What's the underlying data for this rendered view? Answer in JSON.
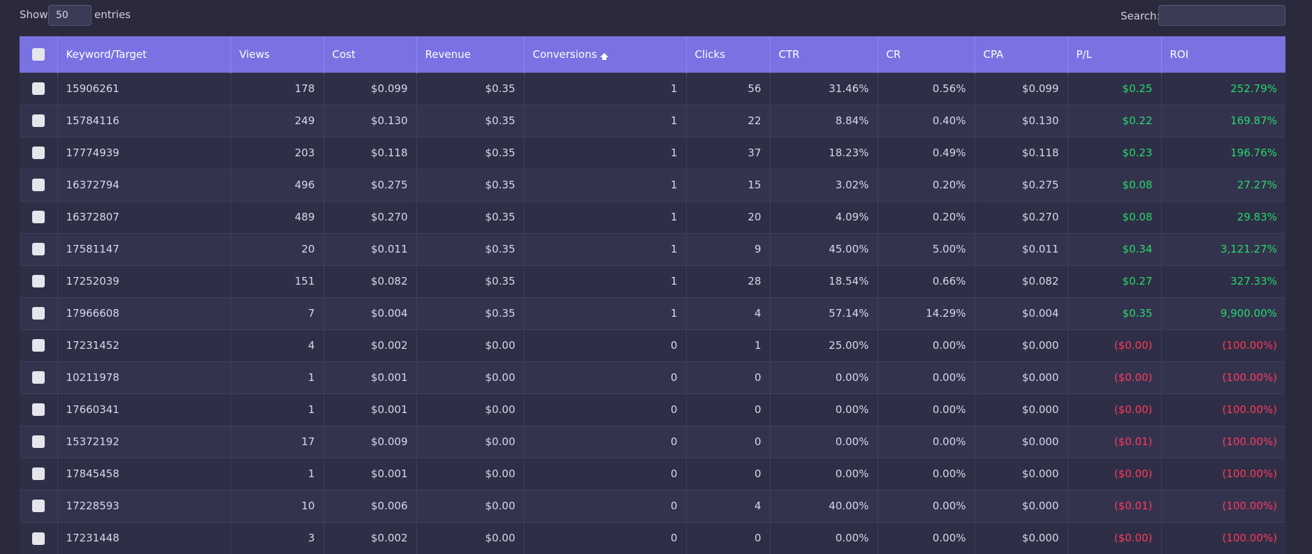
{
  "controls": {
    "show_label": "Show",
    "entries_value": "50",
    "entries_label": "entries",
    "search_label": "Search:",
    "search_value": ""
  },
  "table": {
    "headers": [
      "Keyword/Target",
      "Views",
      "Cost",
      "Revenue",
      "Conversions",
      "Clicks",
      "CTR",
      "CR",
      "CPA",
      "P/L",
      "ROI"
    ],
    "sorted_column": "Conversions",
    "sort_icon": "sort-asc-icon",
    "colors": {
      "header_bg": "#7a72e2",
      "positive": "#27d96b",
      "negative": "#ff3b5a"
    },
    "rows": [
      [
        "15906261",
        "178",
        "$0.099",
        "$0.35",
        "1",
        "56",
        "31.46%",
        "0.56%",
        "$0.099",
        "$0.25",
        "252.79%"
      ],
      [
        "15784116",
        "249",
        "$0.130",
        "$0.35",
        "1",
        "22",
        "8.84%",
        "0.40%",
        "$0.130",
        "$0.22",
        "169.87%"
      ],
      [
        "17774939",
        "203",
        "$0.118",
        "$0.35",
        "1",
        "37",
        "18.23%",
        "0.49%",
        "$0.118",
        "$0.23",
        "196.76%"
      ],
      [
        "16372794",
        "496",
        "$0.275",
        "$0.35",
        "1",
        "15",
        "3.02%",
        "0.20%",
        "$0.275",
        "$0.08",
        "27.27%"
      ],
      [
        "16372807",
        "489",
        "$0.270",
        "$0.35",
        "1",
        "20",
        "4.09%",
        "0.20%",
        "$0.270",
        "$0.08",
        "29.83%"
      ],
      [
        "17581147",
        "20",
        "$0.011",
        "$0.35",
        "1",
        "9",
        "45.00%",
        "5.00%",
        "$0.011",
        "$0.34",
        "3,121.27%"
      ],
      [
        "17252039",
        "151",
        "$0.082",
        "$0.35",
        "1",
        "28",
        "18.54%",
        "0.66%",
        "$0.082",
        "$0.27",
        "327.33%"
      ],
      [
        "17966608",
        "7",
        "$0.004",
        "$0.35",
        "1",
        "4",
        "57.14%",
        "14.29%",
        "$0.004",
        "$0.35",
        "9,900.00%"
      ],
      [
        "17231452",
        "4",
        "$0.002",
        "$0.00",
        "0",
        "1",
        "25.00%",
        "0.00%",
        "$0.000",
        "($0.00)",
        "(100.00%)"
      ],
      [
        "10211978",
        "1",
        "$0.001",
        "$0.00",
        "0",
        "0",
        "0.00%",
        "0.00%",
        "$0.000",
        "($0.00)",
        "(100.00%)"
      ],
      [
        "17660341",
        "1",
        "$0.001",
        "$0.00",
        "0",
        "0",
        "0.00%",
        "0.00%",
        "$0.000",
        "($0.00)",
        "(100.00%)"
      ],
      [
        "15372192",
        "17",
        "$0.009",
        "$0.00",
        "0",
        "0",
        "0.00%",
        "0.00%",
        "$0.000",
        "($0.01)",
        "(100.00%)"
      ],
      [
        "17845458",
        "1",
        "$0.001",
        "$0.00",
        "0",
        "0",
        "0.00%",
        "0.00%",
        "$0.000",
        "($0.00)",
        "(100.00%)"
      ],
      [
        "17228593",
        "10",
        "$0.006",
        "$0.00",
        "0",
        "4",
        "40.00%",
        "0.00%",
        "$0.000",
        "($0.01)",
        "(100.00%)"
      ],
      [
        "17231448",
        "3",
        "$0.002",
        "$0.00",
        "0",
        "0",
        "0.00%",
        "0.00%",
        "$0.000",
        "($0.00)",
        "(100.00%)"
      ]
    ]
  }
}
